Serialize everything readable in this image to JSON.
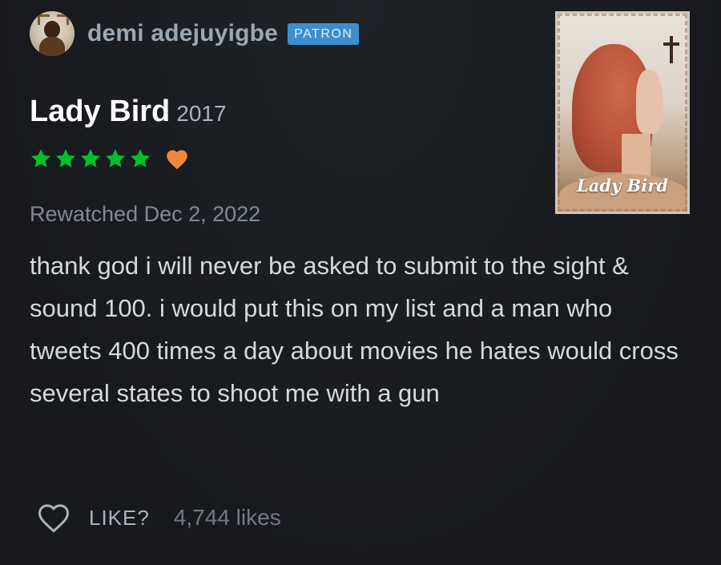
{
  "colors": {
    "background": "#181b20",
    "star_green": "#00c030",
    "heart_orange": "#f0883a",
    "patron_blue": "#3c8fcf"
  },
  "header": {
    "username": "demi adejuyigbe",
    "badge": "PATRON",
    "avatar_icon": "user-avatar"
  },
  "film": {
    "title": "Lady Bird",
    "year": "2017",
    "poster_title": "Lady Bird"
  },
  "rating": {
    "stars": 5,
    "max_stars": 5,
    "liked": true
  },
  "watched_text": "Rewatched Dec 2, 2022",
  "review_text": "thank god i will never be asked to submit to the sight & sound 100. i would put this on my list and a man who tweets 400 times a day about movies he hates would cross several states to shoot me with a gun",
  "footer": {
    "like_label": "LIKE?",
    "likes_count": "4,744 likes"
  }
}
